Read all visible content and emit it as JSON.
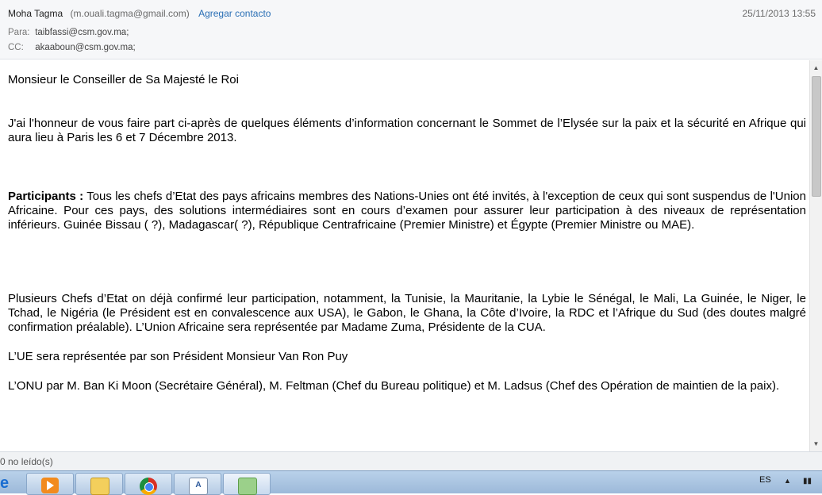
{
  "header": {
    "sender_name": "Moha Tagma",
    "sender_email": "(m.ouali.tagma@gmail.com)",
    "add_contact": "Agregar contacto",
    "date": "25/11/2013 13:55",
    "to_label": "Para:",
    "to_value": "taibfassi@csm.gov.ma;",
    "cc_label": "CC:",
    "cc_value": "akaaboun@csm.gov.ma;"
  },
  "body": {
    "greeting": "Monsieur le Conseiller de Sa Majesté le Roi",
    "intro": "J'ai l'honneur de vous faire part ci-après de quelques éléments d’information concernant le  Sommet de l’Elysée sur la paix et la sécurité en Afrique qui aura lieu à Paris les 6 et 7 Décembre 2013.",
    "participants_label": "Participants :",
    "participants_text": " Tous les chefs d’Etat des pays africains membres des Nations-Unies ont été invités, à l'exception de ceux qui sont suspendus de l'Union Africaine. Pour ces pays, des solutions intermédiaires sont en cours d’examen pour assurer leur participation à des niveaux de représentation inférieurs.  Guinée Bissau ( ?), Madagascar( ?), République Centrafricaine (Premier Ministre) et Égypte (Premier Ministre ou MAE).",
    "confirmed": "Plusieurs Chefs d’Etat on déjà confirmé leur participation, notamment, la Tunisie, la Mauritanie, la Lybie  le Sénégal, le Mali, La Guinée, le Niger, le Tchad, le Nigéria (le Président est en convalescence aux USA), le Gabon, le Ghana, la Côte d’Ivoire, la RDC et l’Afrique du Sud (des doutes malgré confirmation préalable).  L’Union Africaine sera représentée par Madame Zuma, Présidente de la CUA.",
    "ue": "L’UE sera représentée par son Président Monsieur Van Ron Puy",
    "onu": "L’ONU par M. Ban Ki Moon (Secrétaire Général), M. Feltman (Chef du Bureau politique) et M. Ladsus (Chef des Opération de maintien de la paix)."
  },
  "statusbar": {
    "text": "0 no leído(s)"
  },
  "taskbar": {
    "ie_glyph": "e",
    "language": "ES",
    "tray_arrow": "▲",
    "doc_glyph": "A",
    "icons": [
      "internet-explorer-icon",
      "media-player-icon",
      "folder-icon",
      "chrome-icon",
      "word-document-icon",
      "mail-icon"
    ]
  }
}
